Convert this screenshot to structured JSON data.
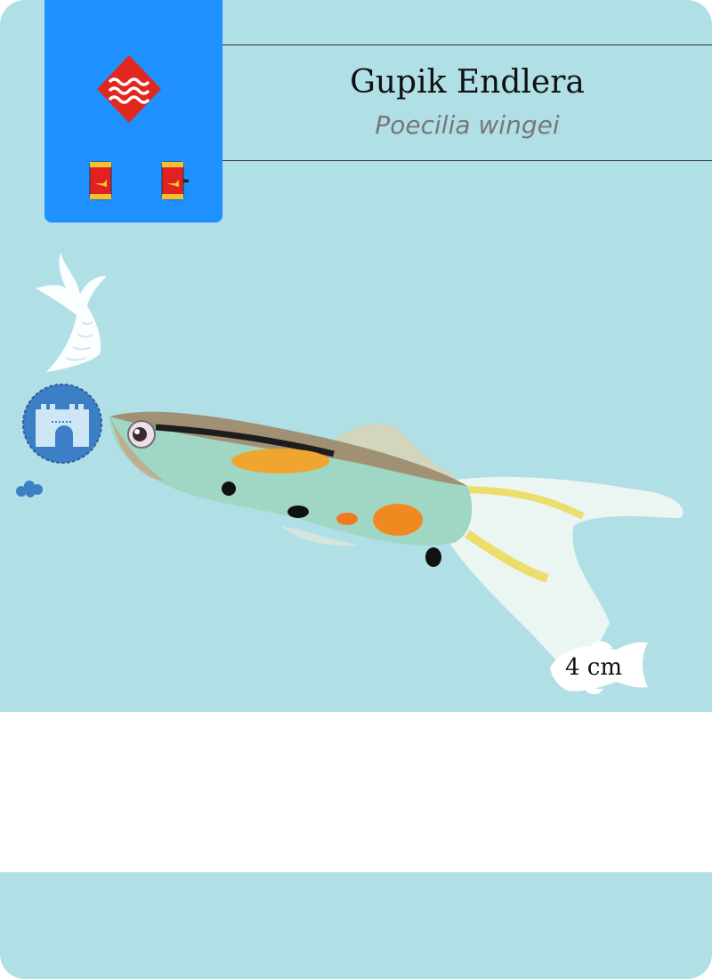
{
  "card": {
    "common_name": "Gupik Endlera",
    "latin_name": "Poecilia wingei",
    "size": "4 cm"
  },
  "food": {
    "operator": "+",
    "item_icon": "fish-food-can-icon"
  },
  "icons": {
    "water_zone": "water-zone-icon",
    "tail_type": "fish-tail-icon",
    "temperament": "castle-icon",
    "group": "eggs-icon"
  },
  "colors": {
    "card_bg": "#b0dfe5",
    "badge_bg": "#1e90ff",
    "water_icon": "#e1281e"
  }
}
